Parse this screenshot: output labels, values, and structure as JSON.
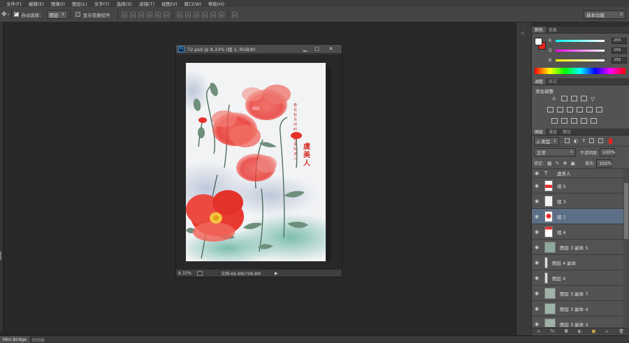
{
  "menu": [
    "文件(F)",
    "编辑(E)",
    "图像(I)",
    "图层(L)",
    "文字(Y)",
    "选择(S)",
    "滤镜(T)",
    "视图(V)",
    "窗口(W)",
    "帮助(H)"
  ],
  "options": {
    "auto_select_label": "自动选择：",
    "auto_select_value": "图层",
    "show_transform_label": "显示变换控件",
    "workspace": "基本功能"
  },
  "document": {
    "title": "72.psd @ 8.33% (组 1, RGB/8)",
    "zoom": "8.33%",
    "doc_info": "文档:69.9M/708.8M",
    "poem_title": "虞美人",
    "poem_text": "春花秋月何时了，往事知多少"
  },
  "color_panel": {
    "tabs": [
      "颜色",
      "色板"
    ],
    "channels": [
      {
        "label": "R",
        "value": "255"
      },
      {
        "label": "G",
        "value": "255"
      },
      {
        "label": "B",
        "value": "255"
      }
    ],
    "foreground": "#ffffff",
    "background": "#e8251f"
  },
  "adjust_panel": {
    "tabs": [
      "调整",
      "样式"
    ],
    "heading": "添加调整"
  },
  "layers_panel": {
    "tabs": [
      "图层",
      "通道",
      "路径"
    ],
    "filter_label": "ρ 类型",
    "blend_mode": "正常",
    "opacity_label": "不透明度:",
    "opacity_value": "100%",
    "lock_label": "锁定:",
    "fill_label": "填充:",
    "fill_value": "100%",
    "layers": [
      {
        "name": "虞美人",
        "kind": "text",
        "selected": false
      },
      {
        "name": "组 5",
        "kind": "group",
        "selected": false
      },
      {
        "name": "组 3",
        "kind": "group",
        "selected": false
      },
      {
        "name": "组 1",
        "kind": "group",
        "selected": true
      },
      {
        "name": "组 6",
        "kind": "group",
        "selected": false
      },
      {
        "name": "图层 3 副本 5",
        "kind": "layer",
        "selected": false
      },
      {
        "name": "图层 4 副本",
        "kind": "layer",
        "selected": false
      },
      {
        "name": "图层 4",
        "kind": "layer",
        "selected": false
      },
      {
        "name": "图层 3 副本 7",
        "kind": "layer",
        "selected": false
      },
      {
        "name": "图层 3 副本 4",
        "kind": "layer",
        "selected": false
      },
      {
        "name": "图层 3 副本 3",
        "kind": "layer",
        "selected": false
      }
    ],
    "footer_icons": [
      "link-icon",
      "fx-icon",
      "mask-icon",
      "adjustment-icon",
      "folder-icon",
      "new-layer-icon",
      "trash-icon"
    ]
  },
  "bottom_tabs": [
    "Mini Bridge",
    "时间轴"
  ],
  "colors": {
    "accent_selected": "#5d6f86",
    "poppy_red": "#e8302a"
  }
}
